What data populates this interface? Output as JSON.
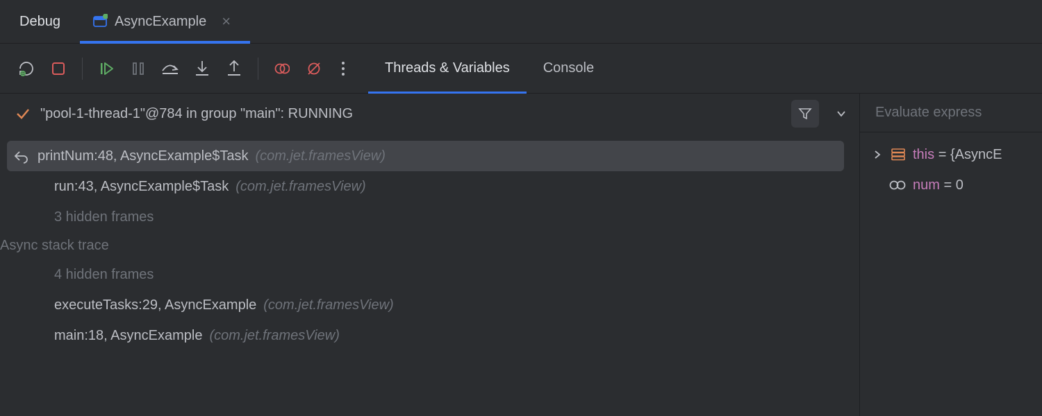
{
  "header": {
    "title": "Debug",
    "tab_label": "AsyncExample"
  },
  "debug_tabs": {
    "threads": "Threads & Variables",
    "console": "Console"
  },
  "thread": {
    "status": "\"pool-1-thread-1\"@784 in group \"main\": RUNNING"
  },
  "frames": {
    "f0_main": "printNum:48, AsyncExample$Task",
    "f0_pkg": "(com.jet.framesView)",
    "f1_main": "run:43, AsyncExample$Task",
    "f1_pkg": "(com.jet.framesView)",
    "hidden1": "3 hidden frames",
    "async_label": "Async stack trace",
    "hidden2": "4 hidden frames",
    "f2_main": "executeTasks:29, AsyncExample",
    "f2_pkg": "(com.jet.framesView)",
    "f3_main": "main:18, AsyncExample",
    "f3_pkg": "(com.jet.framesView)"
  },
  "eval": {
    "placeholder": "Evaluate express"
  },
  "vars": {
    "v0_name": "this",
    "v0_val": "{AsyncE",
    "v1_name": "num",
    "v1_val": "0"
  }
}
